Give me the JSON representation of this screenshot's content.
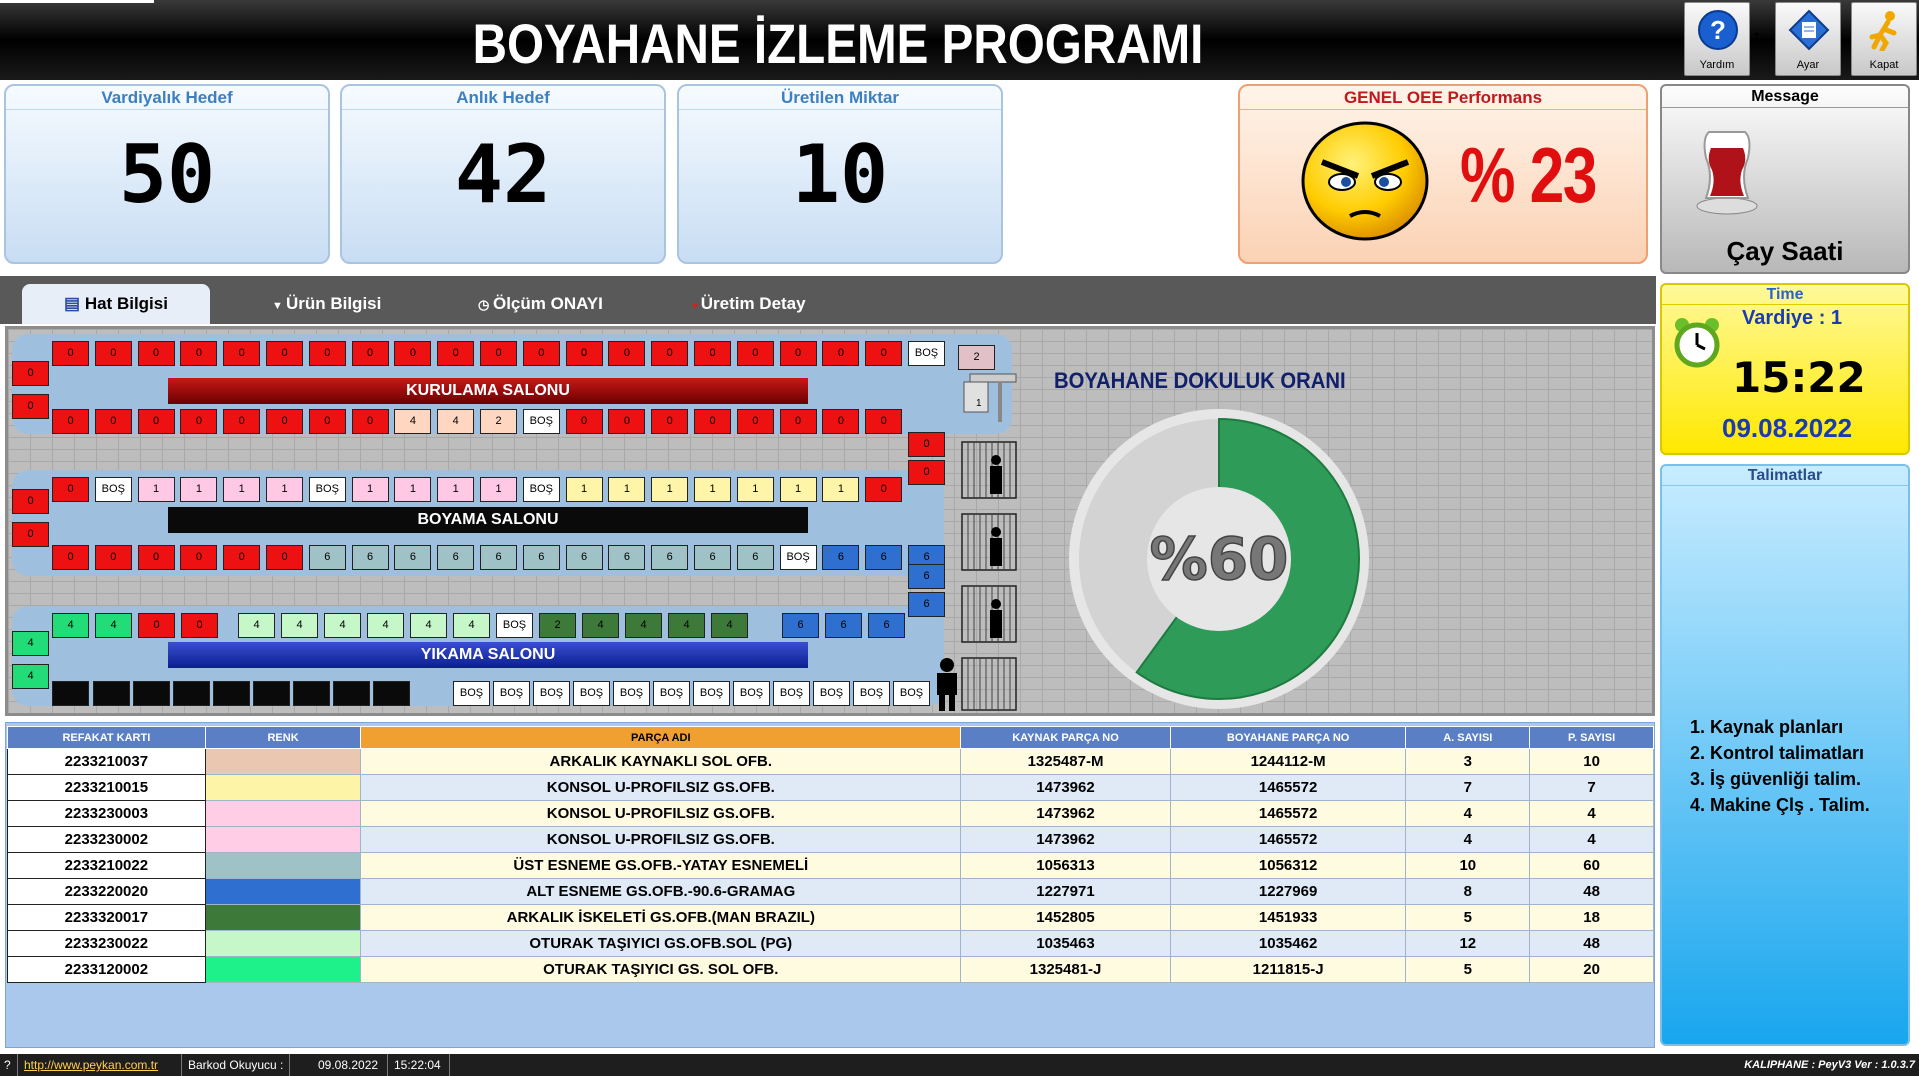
{
  "app_title": "BOYAHANE İZLEME PROGRAMI",
  "toolbar": {
    "help_label": "Yardım",
    "settings_label": "Ayar",
    "close_label": "Kapat"
  },
  "kpis": [
    {
      "title": "Vardiyalık Hedef",
      "value": "50"
    },
    {
      "title": "Anlık Hedef",
      "value": "42"
    },
    {
      "title": "Üretilen Miktar",
      "value": "10"
    }
  ],
  "oee": {
    "title": "GENEL OEE Performans",
    "value": "% 23",
    "icon": "angry-face-icon"
  },
  "message": {
    "title": "Message",
    "text": "Çay Saati",
    "icon": "tea-glass-icon"
  },
  "time": {
    "title": "Time",
    "shift": "Vardiye : 1",
    "clock": "15:22",
    "date": "09.08.2022",
    "icon": "alarm-clock-icon"
  },
  "instructions": {
    "title": "Talimatlar",
    "items": [
      "1. Kaynak planları",
      "2. Kontrol talimatları",
      "3. İş güvenliği talim.",
      "4. Makine Çlş . Talim."
    ]
  },
  "tabs": [
    {
      "label": "Hat Bilgisi",
      "icon": "list-icon"
    },
    {
      "label": "Ürün Bilgisi",
      "icon": "filter-icon"
    },
    {
      "label": "Ölçüm ONAYI",
      "icon": "clock-icon"
    },
    {
      "label": "Üretim Detay",
      "icon": "heart-icon"
    }
  ],
  "line": {
    "salons": [
      "KURULAMA SALONU",
      "BOYAMA SALONU",
      "YIKAMA SALONU"
    ],
    "row1": [
      "0",
      "0",
      "0",
      "0",
      "0",
      "0",
      "0",
      "0",
      "0",
      "0",
      "0",
      "0",
      "0",
      "0",
      "0",
      "0",
      "0",
      "0",
      "0",
      "0",
      "BOŞ"
    ],
    "row2": [
      "0",
      "0",
      "0",
      "0",
      "0",
      "0",
      "0",
      "0",
      "4",
      "4",
      "2",
      "BOŞ",
      "0",
      "0",
      "0",
      "0",
      "0",
      "0",
      "0",
      "0"
    ],
    "row3": [
      "0",
      "BOŞ",
      "1",
      "1",
      "1",
      "1",
      "BOŞ",
      "1",
      "1",
      "1",
      "1",
      "BOŞ",
      "1",
      "1",
      "1",
      "1",
      "1",
      "1",
      "1",
      "0"
    ],
    "row4": [
      "0",
      "0",
      "0",
      "0",
      "0",
      "0",
      "6",
      "6",
      "6",
      "6",
      "6",
      "6",
      "6",
      "6",
      "6",
      "6",
      "6",
      "BOŞ",
      "6",
      "6",
      "6"
    ],
    "row5": [
      "4",
      "4",
      "0",
      "0",
      "4",
      "4",
      "4",
      "4",
      "4",
      "4",
      "BOŞ",
      "2",
      "4",
      "4",
      "4",
      "4",
      "6",
      "6",
      "6"
    ],
    "row6": [
      "",
      "",
      "",
      "",
      "",
      "",
      "",
      "",
      "",
      "BOŞ",
      "BOŞ",
      "BOŞ",
      "BOŞ",
      "BOŞ",
      "BOŞ",
      "BOŞ",
      "BOŞ",
      "BOŞ",
      "BOŞ",
      "BOŞ",
      "BOŞ"
    ],
    "left_col": [
      "0",
      "0",
      "0",
      "0",
      "4",
      "4"
    ],
    "right_col": [
      "2",
      "0",
      "0",
      "6",
      "6"
    ],
    "station_label": "1"
  },
  "density": {
    "title": "BOYAHANE DOKULUK ORANI",
    "value_text": "%60",
    "percent": 60,
    "fill_color": "#2e9b58"
  },
  "table": {
    "headers": [
      "REFAKAT KARTI",
      "RENK",
      "PARÇA ADI",
      "KAYNAK PARÇA NO",
      "BOYAHANE PARÇA NO",
      "A. SAYISI",
      "P. SAYISI"
    ],
    "rows": [
      {
        "card": "2233210037",
        "color": "#e9c7b1",
        "name": "ARKALIK KAYNAKLI SOL OFB.",
        "kaynak": "1325487-M",
        "boya": "1244112-M",
        "a": "3",
        "p": "10"
      },
      {
        "card": "2233210015",
        "color": "#fef4a8",
        "name": "KONSOL U-PROFILSIZ GS.OFB.",
        "kaynak": "1473962",
        "boya": "1465572",
        "a": "7",
        "p": "7"
      },
      {
        "card": "2233230003",
        "color": "#ffcde6",
        "name": "KONSOL U-PROFILSIZ GS.OFB.",
        "kaynak": "1473962",
        "boya": "1465572",
        "a": "4",
        "p": "4"
      },
      {
        "card": "2233230002",
        "color": "#ffcde6",
        "name": "KONSOL U-PROFILSIZ GS.OFB.",
        "kaynak": "1473962",
        "boya": "1465572",
        "a": "4",
        "p": "4"
      },
      {
        "card": "2233210022",
        "color": "#9ec2c6",
        "name": "ÜST ESNEME GS.OFB.-YATAY ESNEMELİ",
        "kaynak": "1056313",
        "boya": "1056312",
        "a": "10",
        "p": "60"
      },
      {
        "card": "2233220020",
        "color": "#2f6fd0",
        "name": "ALT ESNEME GS.OFB.-90.6-GRAMAG",
        "kaynak": "1227971",
        "boya": "1227969",
        "a": "8",
        "p": "48"
      },
      {
        "card": "2233320017",
        "color": "#3d7a3a",
        "name": "ARKALIK İSKELETİ GS.OFB.(MAN BRAZIL)",
        "kaynak": "1452805",
        "boya": "1451933",
        "a": "5",
        "p": "18"
      },
      {
        "card": "2233230022",
        "color": "#c6f7c8",
        "name": "OTURAK TAŞIYICI GS.OFB.SOL (PG)",
        "kaynak": "1035463",
        "boya": "1035462",
        "a": "12",
        "p": "48"
      },
      {
        "card": "2233120002",
        "color": "#1ef08a",
        "name": "OTURAK TAŞIYICI GS. SOL OFB.",
        "kaynak": "1325481-J",
        "boya": "1211815-J",
        "a": "5",
        "p": "20"
      }
    ]
  },
  "status": {
    "help": "?",
    "url": "http://www.peykan.com.tr",
    "barcode_label": "Barkod Okuyucu :",
    "date": "09.08.2022",
    "time": "15:22:04",
    "version": "KALIPHANE : PeyV3   Ver : 1.0.3.7"
  }
}
